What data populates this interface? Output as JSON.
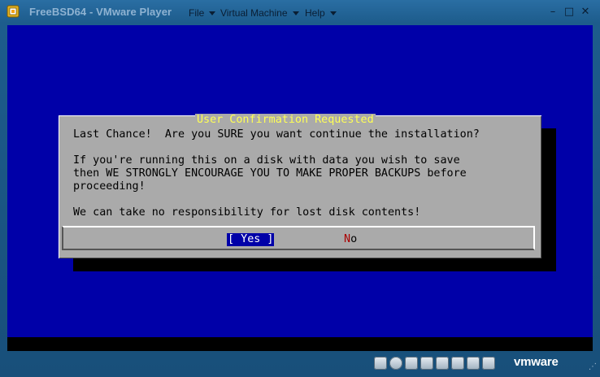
{
  "window": {
    "title": "FreeBSD64 - VMware Player",
    "menu": [
      {
        "label": "File",
        "has_arrow": true
      },
      {
        "label": "Virtual Machine",
        "has_arrow": true
      },
      {
        "label": "Help",
        "has_arrow": true
      }
    ],
    "controls": {
      "minimize": "–",
      "maximize": "□",
      "close": "✕"
    }
  },
  "dialog": {
    "title": "User Confirmation Requested",
    "lines": [
      "Last Chance!  Are you SURE you want continue the installation?",
      "",
      "If you're running this on a disk with data you wish to save",
      "then WE STRONGLY ENCOURAGE YOU TO MAKE PROPER BACKUPS before",
      "proceeding!",
      "",
      "We can take no responsibility for lost disk contents!"
    ],
    "buttons": {
      "yes": {
        "open": "[ ",
        "hot": "Y",
        "rest": "es",
        "close": " ]",
        "selected": true
      },
      "no": {
        "hot": "N",
        "rest": "o"
      }
    }
  },
  "statusbar": {
    "brand": "vmware",
    "device_icons": [
      "network-icon",
      "cd-icon",
      "floppy-icon",
      "usb-icon",
      "sound-icon",
      "printer-icon",
      "screen-icon",
      "message-icon"
    ]
  },
  "colors": {
    "guest_bg": "#0000a8",
    "dialog_bg": "#aaaaaa",
    "dialog_title": "#ffff55",
    "hotkey_red": "#aa0000"
  }
}
